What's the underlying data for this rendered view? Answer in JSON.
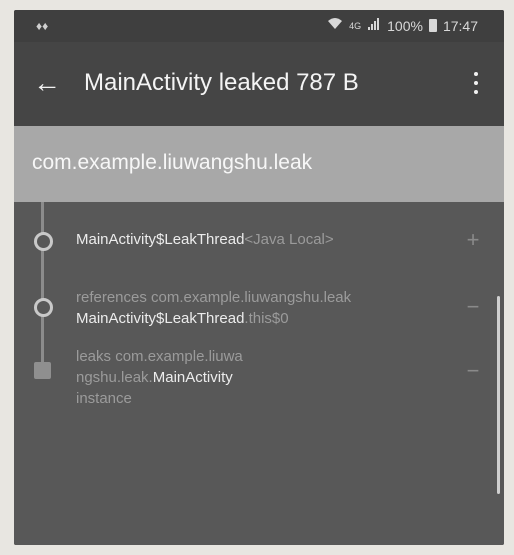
{
  "status_bar": {
    "left_indicator": "♦♦",
    "network": "4G",
    "battery": "100%",
    "time": "17:47"
  },
  "app_bar": {
    "back_icon": "←",
    "title": "MainActivity leaked 787 B",
    "overflow_icon": "vertical-dots"
  },
  "header": {
    "package": "com.example.liuwangshu.leak"
  },
  "trace": [
    {
      "line1_strong": "MainActivity$LeakThread",
      "line1_dim": "<Java Local>",
      "expand": "+"
    },
    {
      "line1_prefix": "references",
      "line1_dim": "com.example.liuwangshu.leak",
      "line2_strong": "MainActivity$LeakThread",
      "line2_dim": ".this$0",
      "expand": "−"
    },
    {
      "line1_prefix": "leaks",
      "line1_dim": "com.example.liuwa",
      "line2_dim": "ngshu.leak.",
      "line2_strong": "MainActivity",
      "line3": "instance",
      "expand": "−"
    }
  ],
  "colors": {
    "app_bar": "#454545",
    "header": "#a8a8a8",
    "content": "#585858"
  }
}
